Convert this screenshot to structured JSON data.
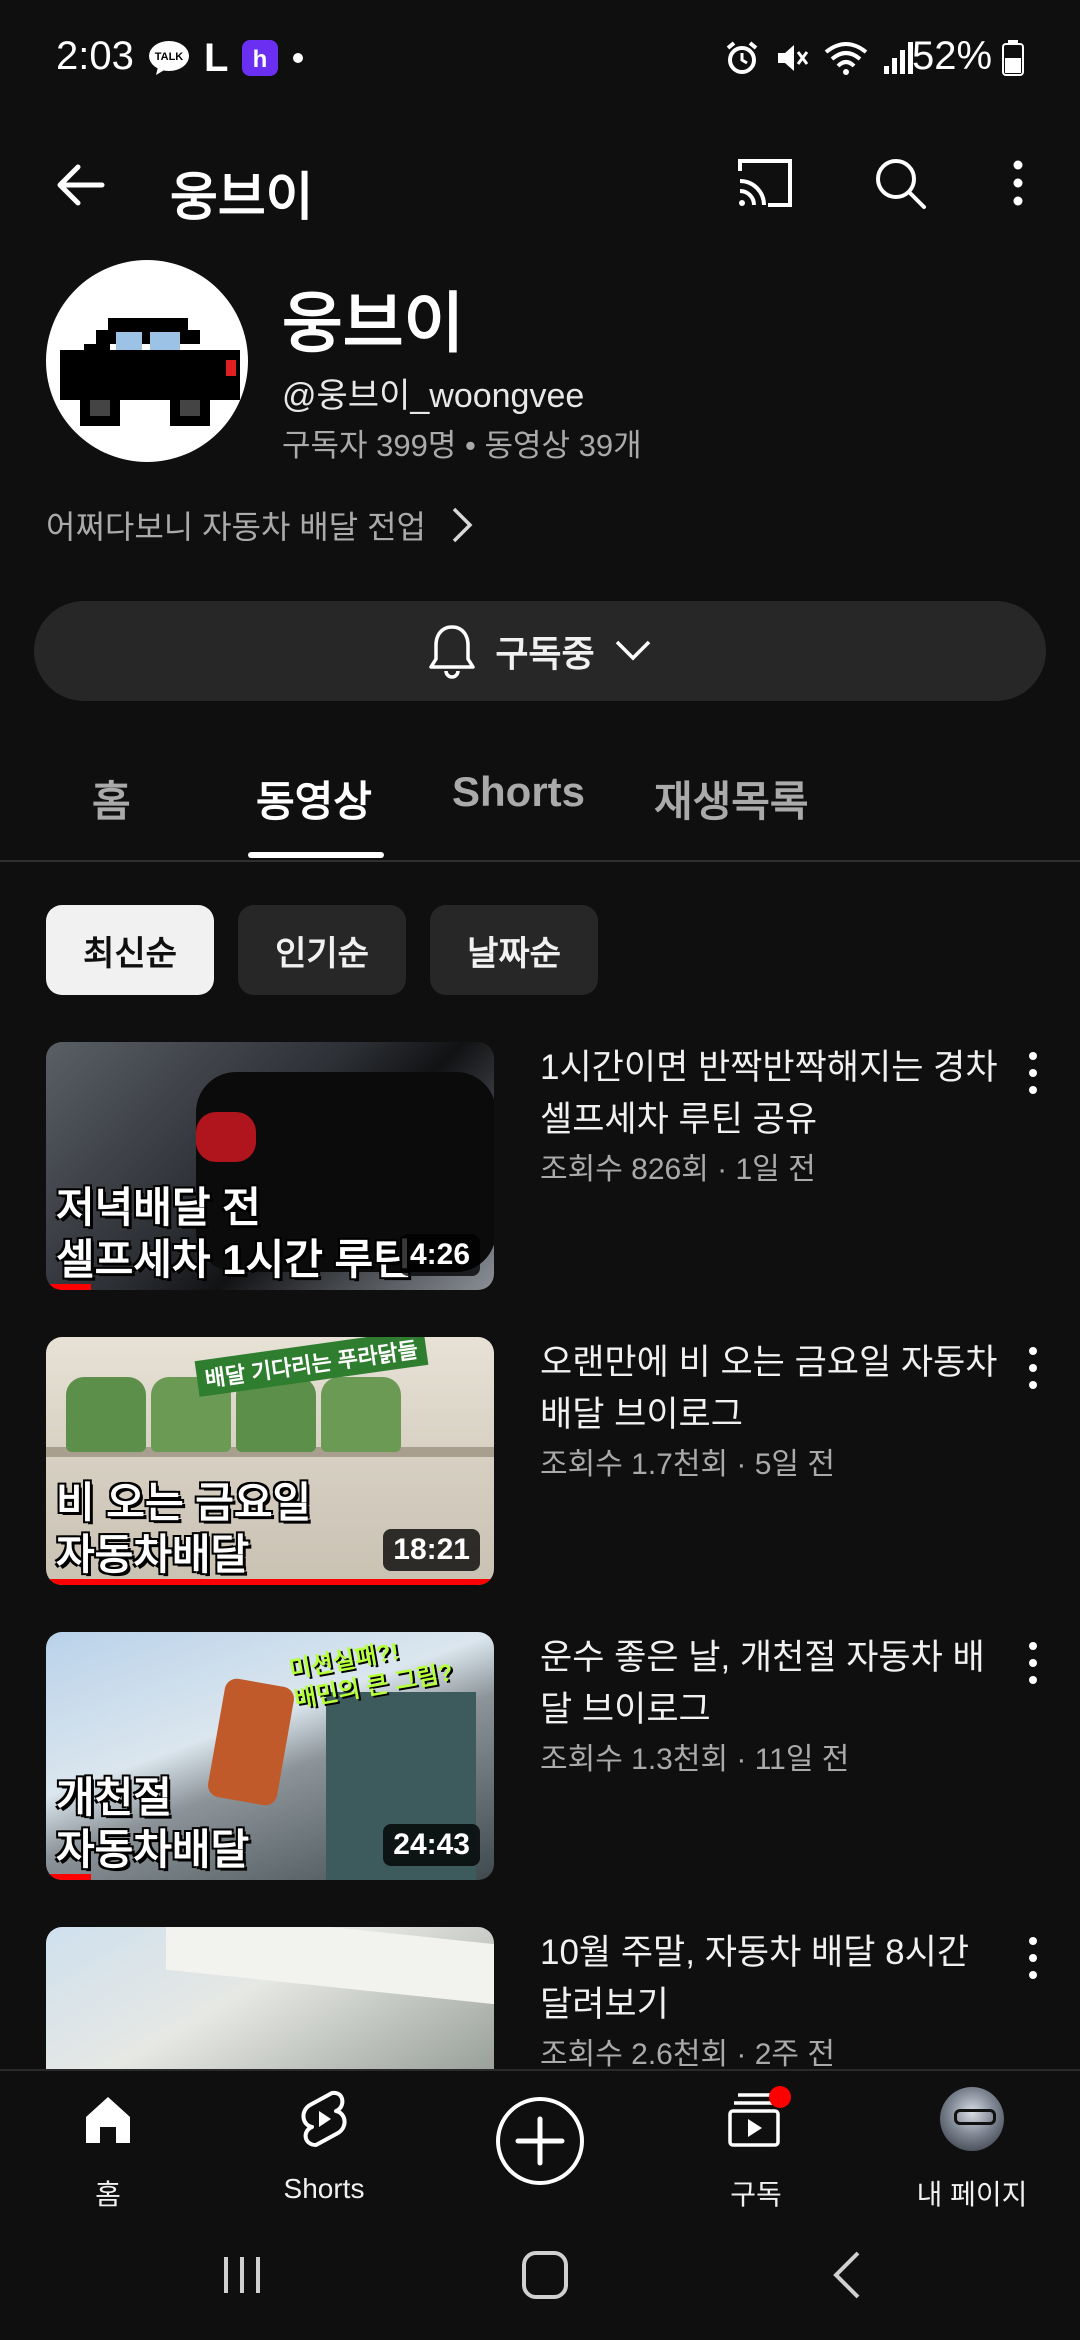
{
  "status_bar": {
    "time": "2:03",
    "battery": "52%",
    "app_badge": "L",
    "talk_label": "TALK"
  },
  "app_bar": {
    "title": "웅브이"
  },
  "channel": {
    "name": "웅브이",
    "handle": "@웅브이_woongvee",
    "stats": "구독자 399명 • 동영상 39개",
    "description": "어쩌다보니 자동차 배달 전업",
    "subscribe_label": "구독중"
  },
  "tabs": [
    {
      "label": "홈"
    },
    {
      "label": "동영상"
    },
    {
      "label": "Shorts"
    },
    {
      "label": "재생목록"
    }
  ],
  "active_tab": "동영상",
  "chips": [
    {
      "label": "최신순",
      "selected": true
    },
    {
      "label": "인기순",
      "selected": false
    },
    {
      "label": "날짜순",
      "selected": false
    }
  ],
  "videos": [
    {
      "title": "1시간이면 반짝반짝해지는 경차 셀프세차 루틴 공유",
      "meta": "조회수 826회 · 1일 전",
      "duration": "4:26",
      "thumb_text": [
        "저녁배달 전",
        "셀프세차 1시간 루틴"
      ],
      "watch_progress": 0.1
    },
    {
      "title": "오랜만에 비 오는 금요일 자동차 배달 브이로그",
      "meta": "조회수 1.7천회 · 5일 전",
      "duration": "18:21",
      "thumb_text": [
        "비 오는 금요일",
        "자동차배달"
      ],
      "badge_text": "배달 기다리는 푸라닭들",
      "watch_progress": 1.0
    },
    {
      "title": "운수 좋은 날, 개천절 자동차 배달 브이로그",
      "meta": "조회수 1.3천회 · 11일 전",
      "duration": "24:43",
      "thumb_text": [
        "개천절",
        "자동차배달"
      ],
      "badge_text": [
        "미션실패?!",
        "배민의 큰 그림?"
      ],
      "watch_progress": 0.1
    },
    {
      "title": "10월 주말, 자동차 배달 8시간 달려보기",
      "meta": "조회수 2.6천회 · 2주 전"
    }
  ],
  "bottom_nav": [
    {
      "label": "홈",
      "icon": "home-icon"
    },
    {
      "label": "Shorts",
      "icon": "shorts-icon"
    },
    {
      "label": "",
      "icon": "create-icon"
    },
    {
      "label": "구독",
      "icon": "subscriptions-icon"
    },
    {
      "label": "내 페이지",
      "icon": "profile-avatar"
    }
  ],
  "colors": {
    "background": "#0f0f0f",
    "chip": "#272727",
    "accent_red": "#ff0000",
    "muted_text": "#aaaaaa"
  }
}
